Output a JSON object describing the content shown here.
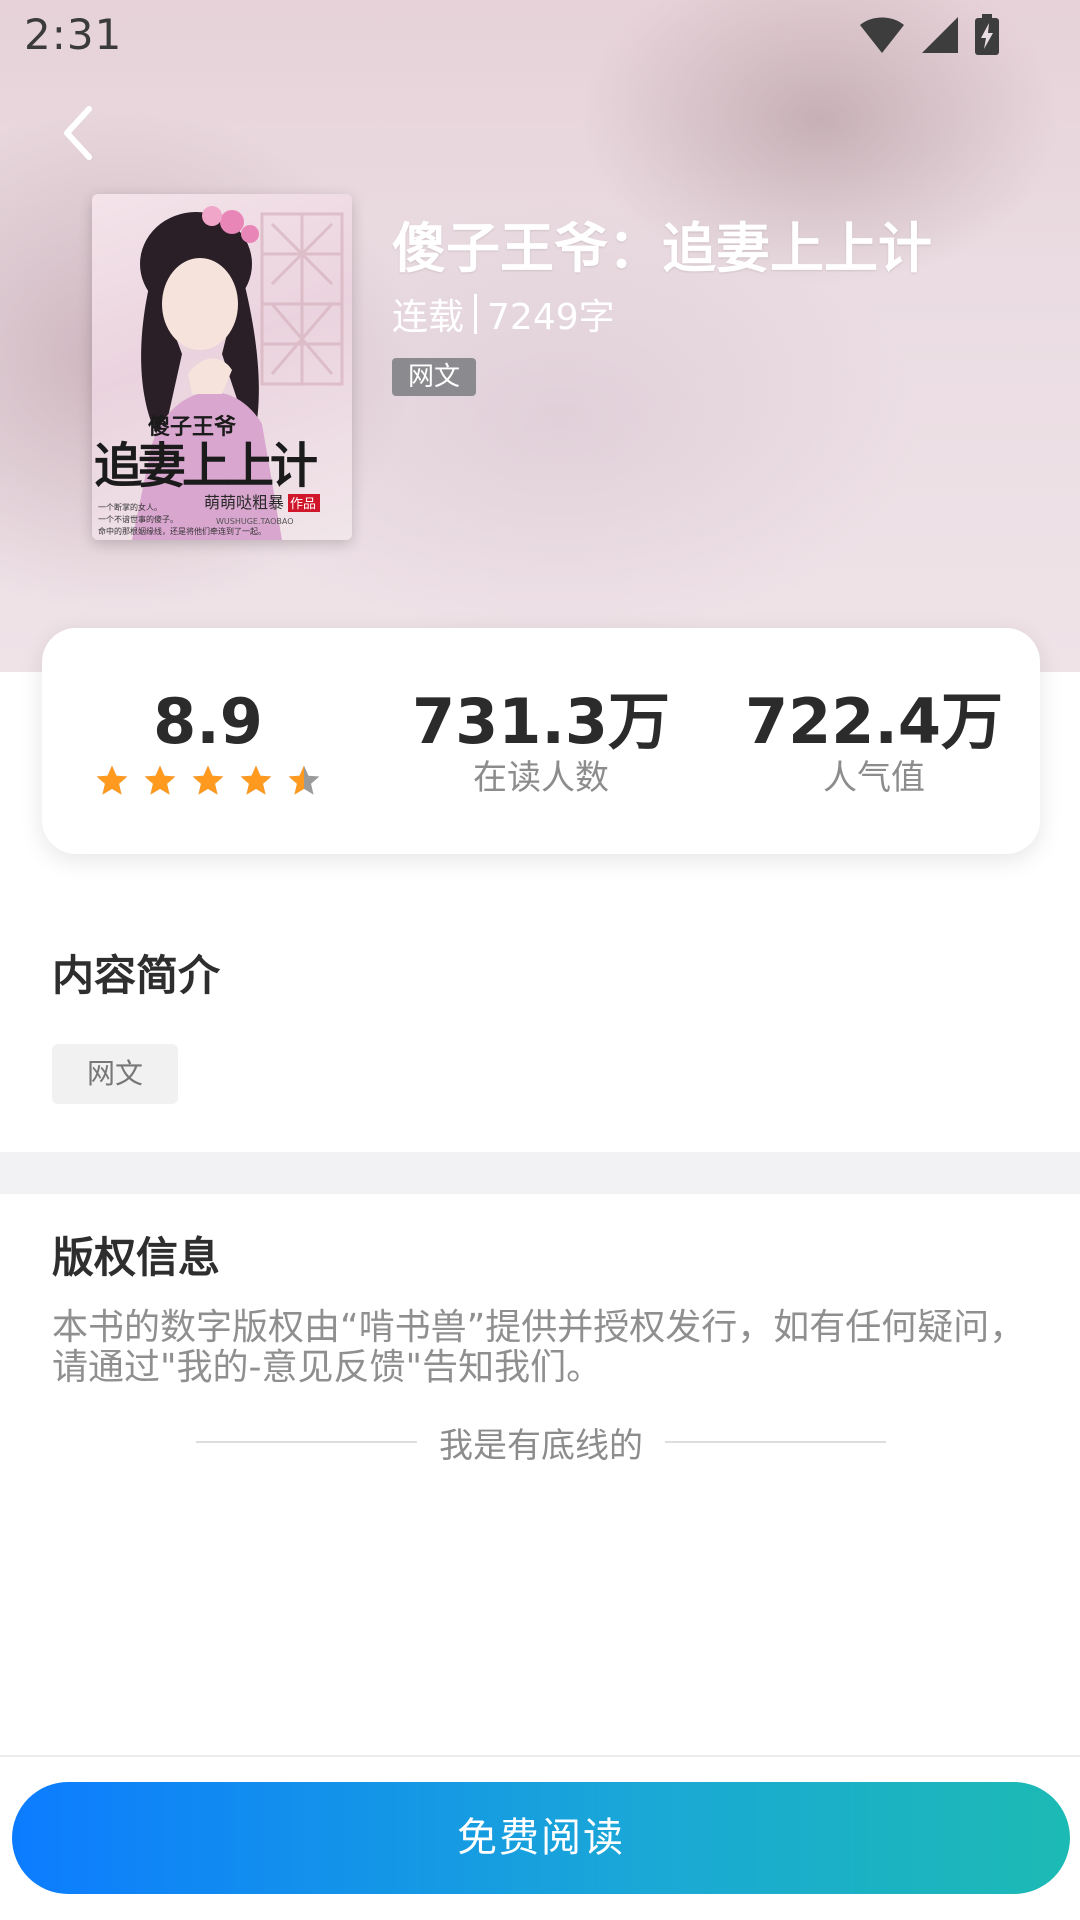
{
  "status_bar": {
    "time": "2:31",
    "icons": [
      "wifi-icon",
      "cellular-signal-icon",
      "battery-charging-icon"
    ]
  },
  "header": {
    "back_icon": "chevron-left-icon"
  },
  "book": {
    "title": "傻子王爷：追妻上上计",
    "status": "连载",
    "word_count": "7249字",
    "tag": "网文",
    "cover": {
      "title_small": "傻子王爷",
      "title_large": "追妻上上计",
      "author": "萌萌哒粗暴",
      "author_badge": "作品",
      "site": "WUSHUGE.TAOBAO",
      "blurb": [
        "一个断掌的女人。",
        "一个不谙世事的傻子。",
        "命中的那根姻缘线，还是将他们牵连到了一起。"
      ]
    }
  },
  "stats": {
    "rating": {
      "value": "8.9",
      "stars_out_of_5": 4.5
    },
    "readers": {
      "value": "731.3万",
      "label": "在读人数"
    },
    "popularity": {
      "value": "722.4万",
      "label": "人气值"
    }
  },
  "intro": {
    "title": "内容简介",
    "genre_chip": "网文"
  },
  "copyright": {
    "title": "版权信息",
    "text": "本书的数字版权由“啃书兽”提供并授权发行，如有任何疑问，请通过\"我的-意见反馈\"告知我们。",
    "bottom_line": "我是有底线的"
  },
  "footer": {
    "read_button": "免费阅读"
  },
  "colors": {
    "star": "#ff9a1f",
    "star_empty": "#9a9a9a",
    "button_gradient_start": "#0c7cff",
    "button_gradient_end": "#1cbab4",
    "tag_bg": "#8b8b8f"
  }
}
